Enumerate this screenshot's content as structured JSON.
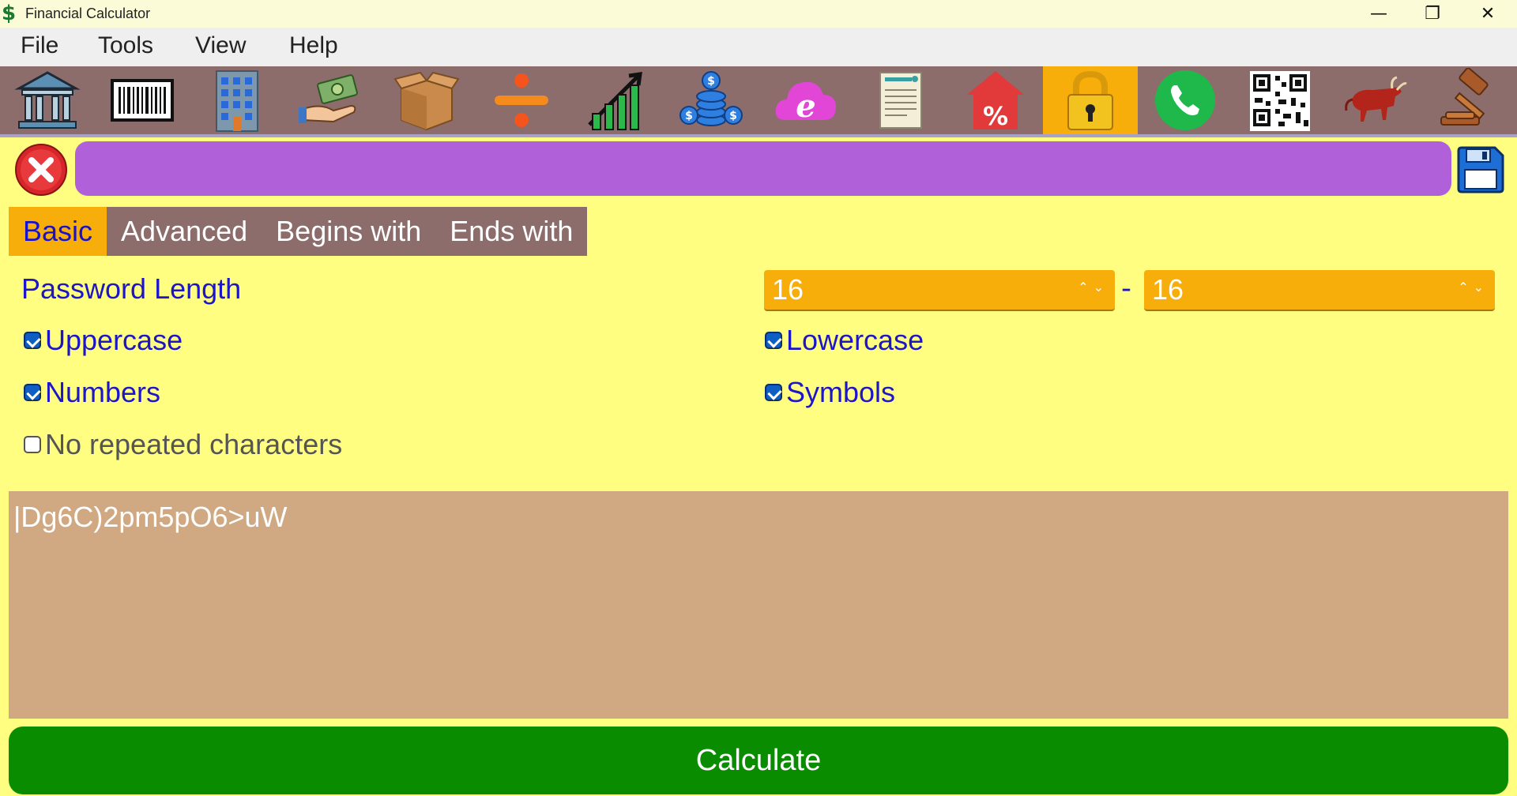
{
  "window": {
    "title": "Financial Calculator",
    "app_icon": "$",
    "controls": {
      "minimize": "—",
      "restore": "❐",
      "close": "✕"
    }
  },
  "menu": [
    "File",
    "Tools",
    "View",
    "Help"
  ],
  "toolbar": {
    "items": [
      {
        "icon": "bank-icon"
      },
      {
        "icon": "barcode-icon"
      },
      {
        "icon": "building-icon"
      },
      {
        "icon": "money-hand-icon"
      },
      {
        "icon": "box-icon"
      },
      {
        "icon": "divide-icon"
      },
      {
        "icon": "growth-chart-icon"
      },
      {
        "icon": "coins-icon"
      },
      {
        "icon": "browser-cloud-icon"
      },
      {
        "icon": "invoice-icon"
      },
      {
        "icon": "percent-house-icon"
      },
      {
        "icon": "lock-icon",
        "active": true
      },
      {
        "icon": "phone-icon"
      },
      {
        "icon": "qr-code-icon"
      },
      {
        "icon": "bull-icon"
      },
      {
        "icon": "gavel-icon"
      }
    ],
    "bg_color": "#8d6c6c",
    "active_color": "#f7ad0a"
  },
  "address_bar": {
    "value": "",
    "color": "#b060d9"
  },
  "tabs": [
    {
      "label": "Basic",
      "active": true
    },
    {
      "label": "Advanced"
    },
    {
      "label": "Begins with"
    },
    {
      "label": "Ends with"
    }
  ],
  "form": {
    "password_length_label": "Password Length",
    "length_min": "16",
    "length_max": "16",
    "range_separator": "-",
    "options": {
      "uppercase": {
        "label": "Uppercase",
        "checked": true
      },
      "lowercase": {
        "label": "Lowercase",
        "checked": true
      },
      "numbers": {
        "label": "Numbers",
        "checked": true
      },
      "symbols": {
        "label": "Symbols",
        "checked": true
      },
      "no_repeat": {
        "label": "No repeated characters",
        "checked": false
      }
    }
  },
  "output": {
    "value": "|Dg6C)2pm5pO6>uW"
  },
  "calculate_label": "Calculate",
  "colors": {
    "background": "#fffe80",
    "label": "#1d16c9",
    "output_bg": "#d0a882",
    "calculate_bg": "#0a8c00"
  }
}
